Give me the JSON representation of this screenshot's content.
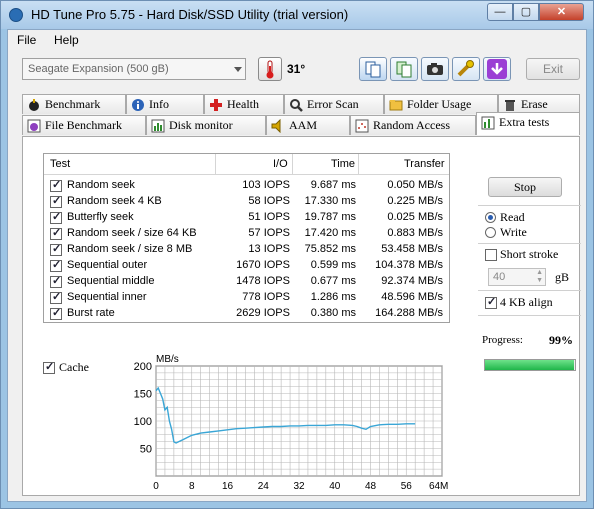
{
  "window": {
    "title": "HD Tune Pro 5.75 - Hard Disk/SSD Utility (trial version)"
  },
  "menu": {
    "file": "File",
    "help": "Help"
  },
  "toolbar": {
    "drive": "Seagate Expansion (500 gB)",
    "temperature": "31",
    "exit_label": "Exit"
  },
  "tabs_row1": [
    "Benchmark",
    "Info",
    "Health",
    "Error Scan",
    "Folder Usage",
    "Erase"
  ],
  "tabs_row2": [
    "File Benchmark",
    "Disk monitor",
    "AAM",
    "Random Access",
    "Extra tests"
  ],
  "table": {
    "headers": [
      "Test",
      "I/O",
      "Time",
      "Transfer"
    ],
    "rows": [
      {
        "test": "Random seek",
        "io": "103 IOPS",
        "time": "9.687 ms",
        "transfer": "0.050 MB/s"
      },
      {
        "test": "Random seek 4 KB",
        "io": "58 IOPS",
        "time": "17.330 ms",
        "transfer": "0.225 MB/s"
      },
      {
        "test": "Butterfly seek",
        "io": "51 IOPS",
        "time": "19.787 ms",
        "transfer": "0.025 MB/s"
      },
      {
        "test": "Random seek / size 64 KB",
        "io": "57 IOPS",
        "time": "17.420 ms",
        "transfer": "0.883 MB/s"
      },
      {
        "test": "Random seek / size 8 MB",
        "io": "13 IOPS",
        "time": "75.852 ms",
        "transfer": "53.458 MB/s"
      },
      {
        "test": "Sequential outer",
        "io": "1670 IOPS",
        "time": "0.599 ms",
        "transfer": "104.378 MB/s"
      },
      {
        "test": "Sequential middle",
        "io": "1478 IOPS",
        "time": "0.677 ms",
        "transfer": "92.374 MB/s"
      },
      {
        "test": "Sequential inner",
        "io": "778 IOPS",
        "time": "1.286 ms",
        "transfer": "48.596 MB/s"
      },
      {
        "test": "Burst rate",
        "io": "2629 IOPS",
        "time": "0.380 ms",
        "transfer": "164.288 MB/s"
      }
    ]
  },
  "cache_label": "Cache",
  "controls": {
    "stop_label": "Stop",
    "read_label": "Read",
    "write_label": "Write",
    "short_stroke_label": "Short stroke",
    "short_stroke_value": "40",
    "short_stroke_unit": "gB",
    "align_label": "4 KB align",
    "progress_label": "Progress:",
    "progress_value": "99%",
    "progress_fraction": 0.99
  },
  "chart_data": {
    "type": "line",
    "ylabel": "MB/s",
    "xunit": "64MB",
    "yticks": [
      50,
      100,
      150,
      200
    ],
    "xticks": [
      0,
      8,
      16,
      24,
      32,
      40,
      48,
      56
    ],
    "xlim": [
      0,
      64
    ],
    "ylim": [
      0,
      200
    ],
    "grid": true,
    "series": [
      {
        "x": [
          0,
          0.5,
          1,
          1.5,
          2,
          2.5,
          3,
          3.5,
          4,
          4.5,
          5,
          6,
          7,
          8,
          10,
          12,
          14,
          16,
          18,
          20,
          22,
          24,
          26,
          28,
          30,
          32,
          34,
          36,
          38,
          40,
          42,
          44,
          45,
          46,
          47,
          48,
          50,
          52,
          54,
          56,
          58
        ],
        "y": [
          155,
          160,
          150,
          140,
          120,
          125,
          100,
          85,
          62,
          60,
          62,
          66,
          70,
          74,
          78,
          80,
          82,
          84,
          86,
          87,
          88,
          89,
          90,
          90,
          91,
          91,
          92,
          92,
          92,
          93,
          93,
          92,
          90,
          87,
          85,
          90,
          93,
          94,
          94,
          95,
          95
        ]
      }
    ],
    "colors": {
      "line": "#3aa6d6",
      "grid": "#b7b7b7",
      "bg": "#ffffff"
    }
  }
}
